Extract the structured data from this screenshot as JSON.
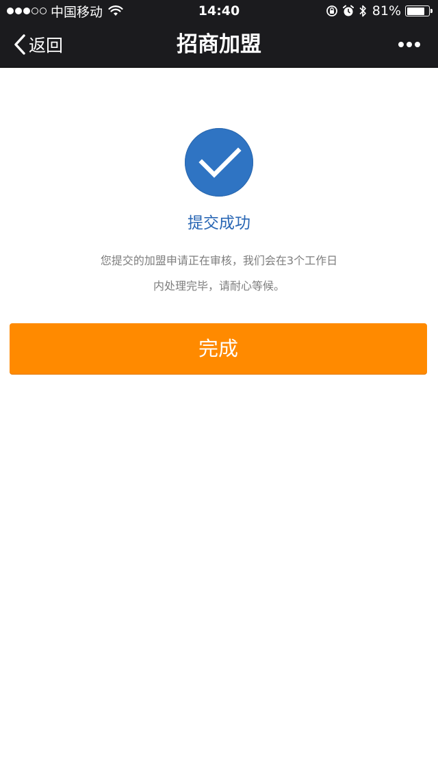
{
  "status_bar": {
    "carrier": "中国移动",
    "time": "14:40",
    "battery": "81%",
    "battery_level": 0.81,
    "signal_bars_filled": 3,
    "signal_bars_total": 5,
    "icons": [
      "wifi-icon",
      "orientation-lock-icon",
      "alarm-icon",
      "bluetooth-icon",
      "battery-icon"
    ]
  },
  "nav": {
    "back_label": "返回",
    "title": "招商加盟",
    "more_icon": "ellipsis-icon"
  },
  "result": {
    "icon": "checkmark-icon",
    "title": "提交成功",
    "desc_line1": "您提交的加盟申请正在审核，我们会在3个工作日",
    "desc_line2": "内处理完毕，请耐心等候。"
  },
  "actions": {
    "done_label": "完成"
  },
  "colors": {
    "nav_background": "#1b1b1e",
    "accent_blue": "#2f74c3",
    "title_blue": "#2866b4",
    "button_orange": "#ff8a00",
    "body_text_gray": "#7d7d7d"
  }
}
